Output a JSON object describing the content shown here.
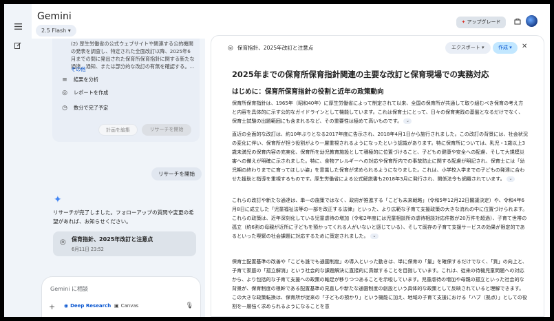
{
  "app": {
    "title": "Gemini",
    "model": "2.5 Flash ▾"
  },
  "rail": {
    "menu_icon": "menu-icon",
    "new_chat_icon": "edit-icon"
  },
  "plan_card": {
    "text": "(2) 厚生労働省の公式ウェブサイトや関連する公的機関の発表を調査し、特定された全面改訂以降、2025年6月までの間に発出された保育所保育指針に関する新たな通達、通知、または部分的な改訂の有無を確認する。...",
    "more": "その他",
    "steps": [
      {
        "icon": "≡",
        "label": "結果を分析"
      },
      {
        "icon": "◎",
        "label": "レポートを作成"
      },
      {
        "icon": "◷",
        "label": "数分で完了予定"
      }
    ],
    "edit_label": "計画を編集",
    "start_label": "リサーチを開始"
  },
  "user_message": "リサーチを開始",
  "reply": "リサーチが完了しました。フォローアップの質問や変更の希望があれば、お知らせください。",
  "doc_card": {
    "title": "保育指針、2025年改訂と注意点",
    "date": "6月11日 23:52"
  },
  "composer": {
    "placeholder": "Gemini に相談",
    "deep_research": "Deep Research",
    "canvas": "Canvas"
  },
  "header_right": {
    "upgrade": "アップグレード"
  },
  "panel": {
    "title": "保育指針、2025年改訂と注意点",
    "export": "エクスポート ▾",
    "create": "作成 ▾",
    "heading1": "2025年までの保育所保育指針関連の主要な改訂と保育現場での実務対応",
    "heading2": "はじめに：保育所保育指針の役割と近年の政策動向",
    "paragraphs": [
      "保育所保育指針は、1965年（昭和40年）に厚生労働省によって制定されて以来、全国の保育所が共通して取り組むべき保育の考え方と内容を具体的に示す公的なガイドラインとして機能しています。これは保育士にとって、日々の保育実践の基盤となるだけでなく、保育士試験の出題範囲にも含まれるなど、その重要性は極めて高いものです。",
      "直近の全面的な改訂は、約10年ぶりとなる2017年度に告示され、2018年4月1日から施行されました。この改訂の背景には、社会状況の変化に伴い、保育所が担う役割がより一層重視されるようになったという認識があります。特に保育所については、乳児・1歳以上3歳未満児の保育内容の充実化、保育所を幼児教育施設として積極的に位置づけること、子どもの健康や安全への配慮、そして大規模災害への備えが明確に示されました。特に、食物アレルギーへの対応や保育所内での事故防止に関する配慮が明記され、保育士には「幼児期の終わりまでに育ってほしい姿」を意識した保育が求められるようになりました。これは、小学校入学までの子どもの発達に合わせた援助と指導を重視するものです。厚生労働省による公式解説書も2018年3月に発行され、関係法令も網羅されています。",
      "これらの改訂や新たな通達は、単一の施策ではなく、政府が推進する「こども未来戦略」（令和5年12月22日閣議決定）や、令和4年6月8日に成立した「児童福祉法等の一部を改正する法律」といった、より広範な子育て支援政策の大きな流れの中に位置づけられます。これらの政策は、近年深刻化している児童虐待の増加（令和2年度には児童相談所の虐待相談対応件数が20万件を超過）、子育て世帯の孤立（約6割の母親が近所に子どもを預かってくれる人がいないと感じている）、そして既存の子育て支援サービスの効果が限定的であるといった喫緊の社会課題に対応するために策定されました。",
      "保育士配置基準の改善や「こども誰でも通園制度」の導入といった動きは、単に保育の「量」を確保するだけでなく、「質」の向上と、子育て家庭の「孤立解消」という社会的な課題解決に直接的に貢献することを目指しています。これは、従来の待機児童問題への対応から、より包括的な子育て支援への政策の軸足が移りつつあることを示唆しています。児童虐待の増加や母親の孤立といった社会的な背景が、保育制度の根幹である配置基準の見直しや新たな通園制度の創設という具体的な政策として反映されていると理解できます。この大きな政策転換は、保育所が従来の「子どもの預かり」という機能に加え、地域の子育て支援における「ハブ（拠点）」としての役割を一層強く求められるようになることを意"
    ]
  }
}
